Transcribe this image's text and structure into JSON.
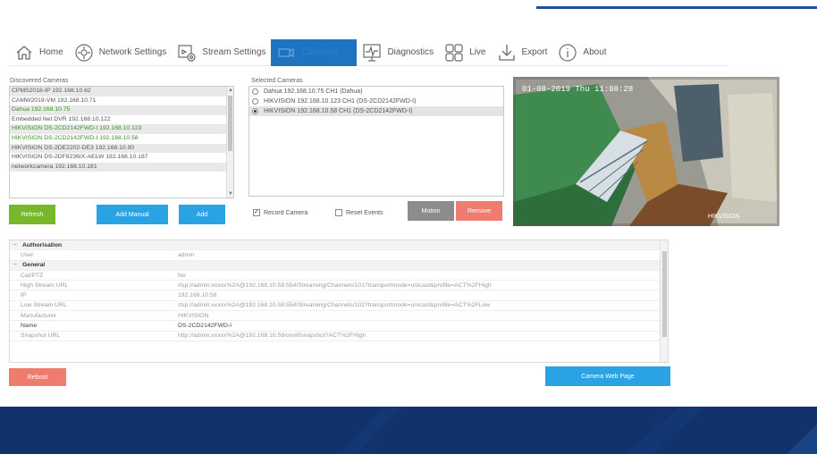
{
  "nav": {
    "items": [
      {
        "label": "Home",
        "icon": "home-icon"
      },
      {
        "label": "Network Settings",
        "icon": "network-gear-icon"
      },
      {
        "label": "Stream Settings",
        "icon": "stream-settings-icon"
      },
      {
        "label": "Cameras",
        "icon": "camera-icon",
        "active": true
      },
      {
        "label": "Diagnostics",
        "icon": "diagnostics-icon"
      },
      {
        "label": "Live",
        "icon": "live-icon"
      },
      {
        "label": "Export",
        "icon": "export-icon"
      },
      {
        "label": "About",
        "icon": "info-icon"
      }
    ]
  },
  "discovered": {
    "title": "Discovered Cameras",
    "items": [
      {
        "text": "CPMS2018-IP 192.168.10.62",
        "style": "alt"
      },
      {
        "text": "CAMW2019-VM 192.168.10.71",
        "style": ""
      },
      {
        "text": "Dahua 192.168.10.75",
        "style": "alt green"
      },
      {
        "text": "Embedded Net DVR 192.168.10.122",
        "style": ""
      },
      {
        "text": "HIKVISION DS-2CD2142FWD-I 192.168.10.123",
        "style": "alt green"
      },
      {
        "text": "HIKVISION DS-2CD2142FWD-I 192.168.10.58",
        "style": "green"
      },
      {
        "text": "HIKVISION DS-2DE2202-DE3 192.168.10.90",
        "style": "alt"
      },
      {
        "text": "HIKVISION DS-2DF8236IX-AELW 192.168.10.187",
        "style": ""
      },
      {
        "text": "networkcamera 192.168.10.181",
        "style": "alt"
      }
    ],
    "refresh_label": "Refresh",
    "add_manual_label": "Add Manual",
    "add_label": "Add"
  },
  "selected": {
    "title": "Selected Cameras",
    "items": [
      {
        "text": "Dahua 192.168.10.75 CH1 (Dahua)",
        "checked": false
      },
      {
        "text": "HIKVISION 192.168.10.123 CH1 (DS-2CD2142FWD-I)",
        "checked": false
      },
      {
        "text": "HIKVISION 192.168.10.58 CH1 (DS-2CD2142FWD-I)",
        "checked": true
      }
    ],
    "record_camera_label": "Record Camera",
    "record_camera_checked": true,
    "reset_events_label": "Reset Events",
    "reset_events_checked": false,
    "motion_label": "Motion",
    "remove_label": "Remove"
  },
  "preview": {
    "timestamp": "01-08-2019 Thu 11:08:28",
    "watermark": "HIKVISION"
  },
  "properties": {
    "categories": [
      {
        "name": "Authorisation",
        "rows": [
          {
            "key": "User",
            "value": "admin",
            "hl": false
          }
        ]
      },
      {
        "name": "General",
        "rows": [
          {
            "key": "Cat/PTZ",
            "value": "No",
            "hl": false
          },
          {
            "key": "High Stream URL",
            "value": "rtsp://admin:xxxxx%2A@192.168.10.58:554/Streaming/Channels/101?transportmode=unicast&profile=ACT%2FHigh",
            "hl": false
          },
          {
            "key": "IP",
            "value": "192.168.10.58",
            "hl": false
          },
          {
            "key": "Low Stream URL",
            "value": "rtsp://admin:xxxxx%2A@192.168.10.58:554/Streaming/Channels/102?transportmode=unicast&profile=ACT%2FLow",
            "hl": false
          },
          {
            "key": "Manufacturer",
            "value": "HIKVISION",
            "hl": false
          },
          {
            "key": "Name",
            "value": "DS-2CD2142FWD-I",
            "hl": true
          },
          {
            "key": "Snapshot URL",
            "value": "http://admin:xxxxx%2A@192.168.10.58/onvif/snapshot?ACT%2FHigh",
            "hl": false
          }
        ]
      }
    ]
  },
  "bottom": {
    "reboot_label": "Reboot",
    "web_page_label": "Camera Web Page"
  },
  "colors": {
    "accent_blue": "#29a3e3",
    "green": "#76b82a",
    "red": "#ef7d6f",
    "footer": "#11326b"
  }
}
